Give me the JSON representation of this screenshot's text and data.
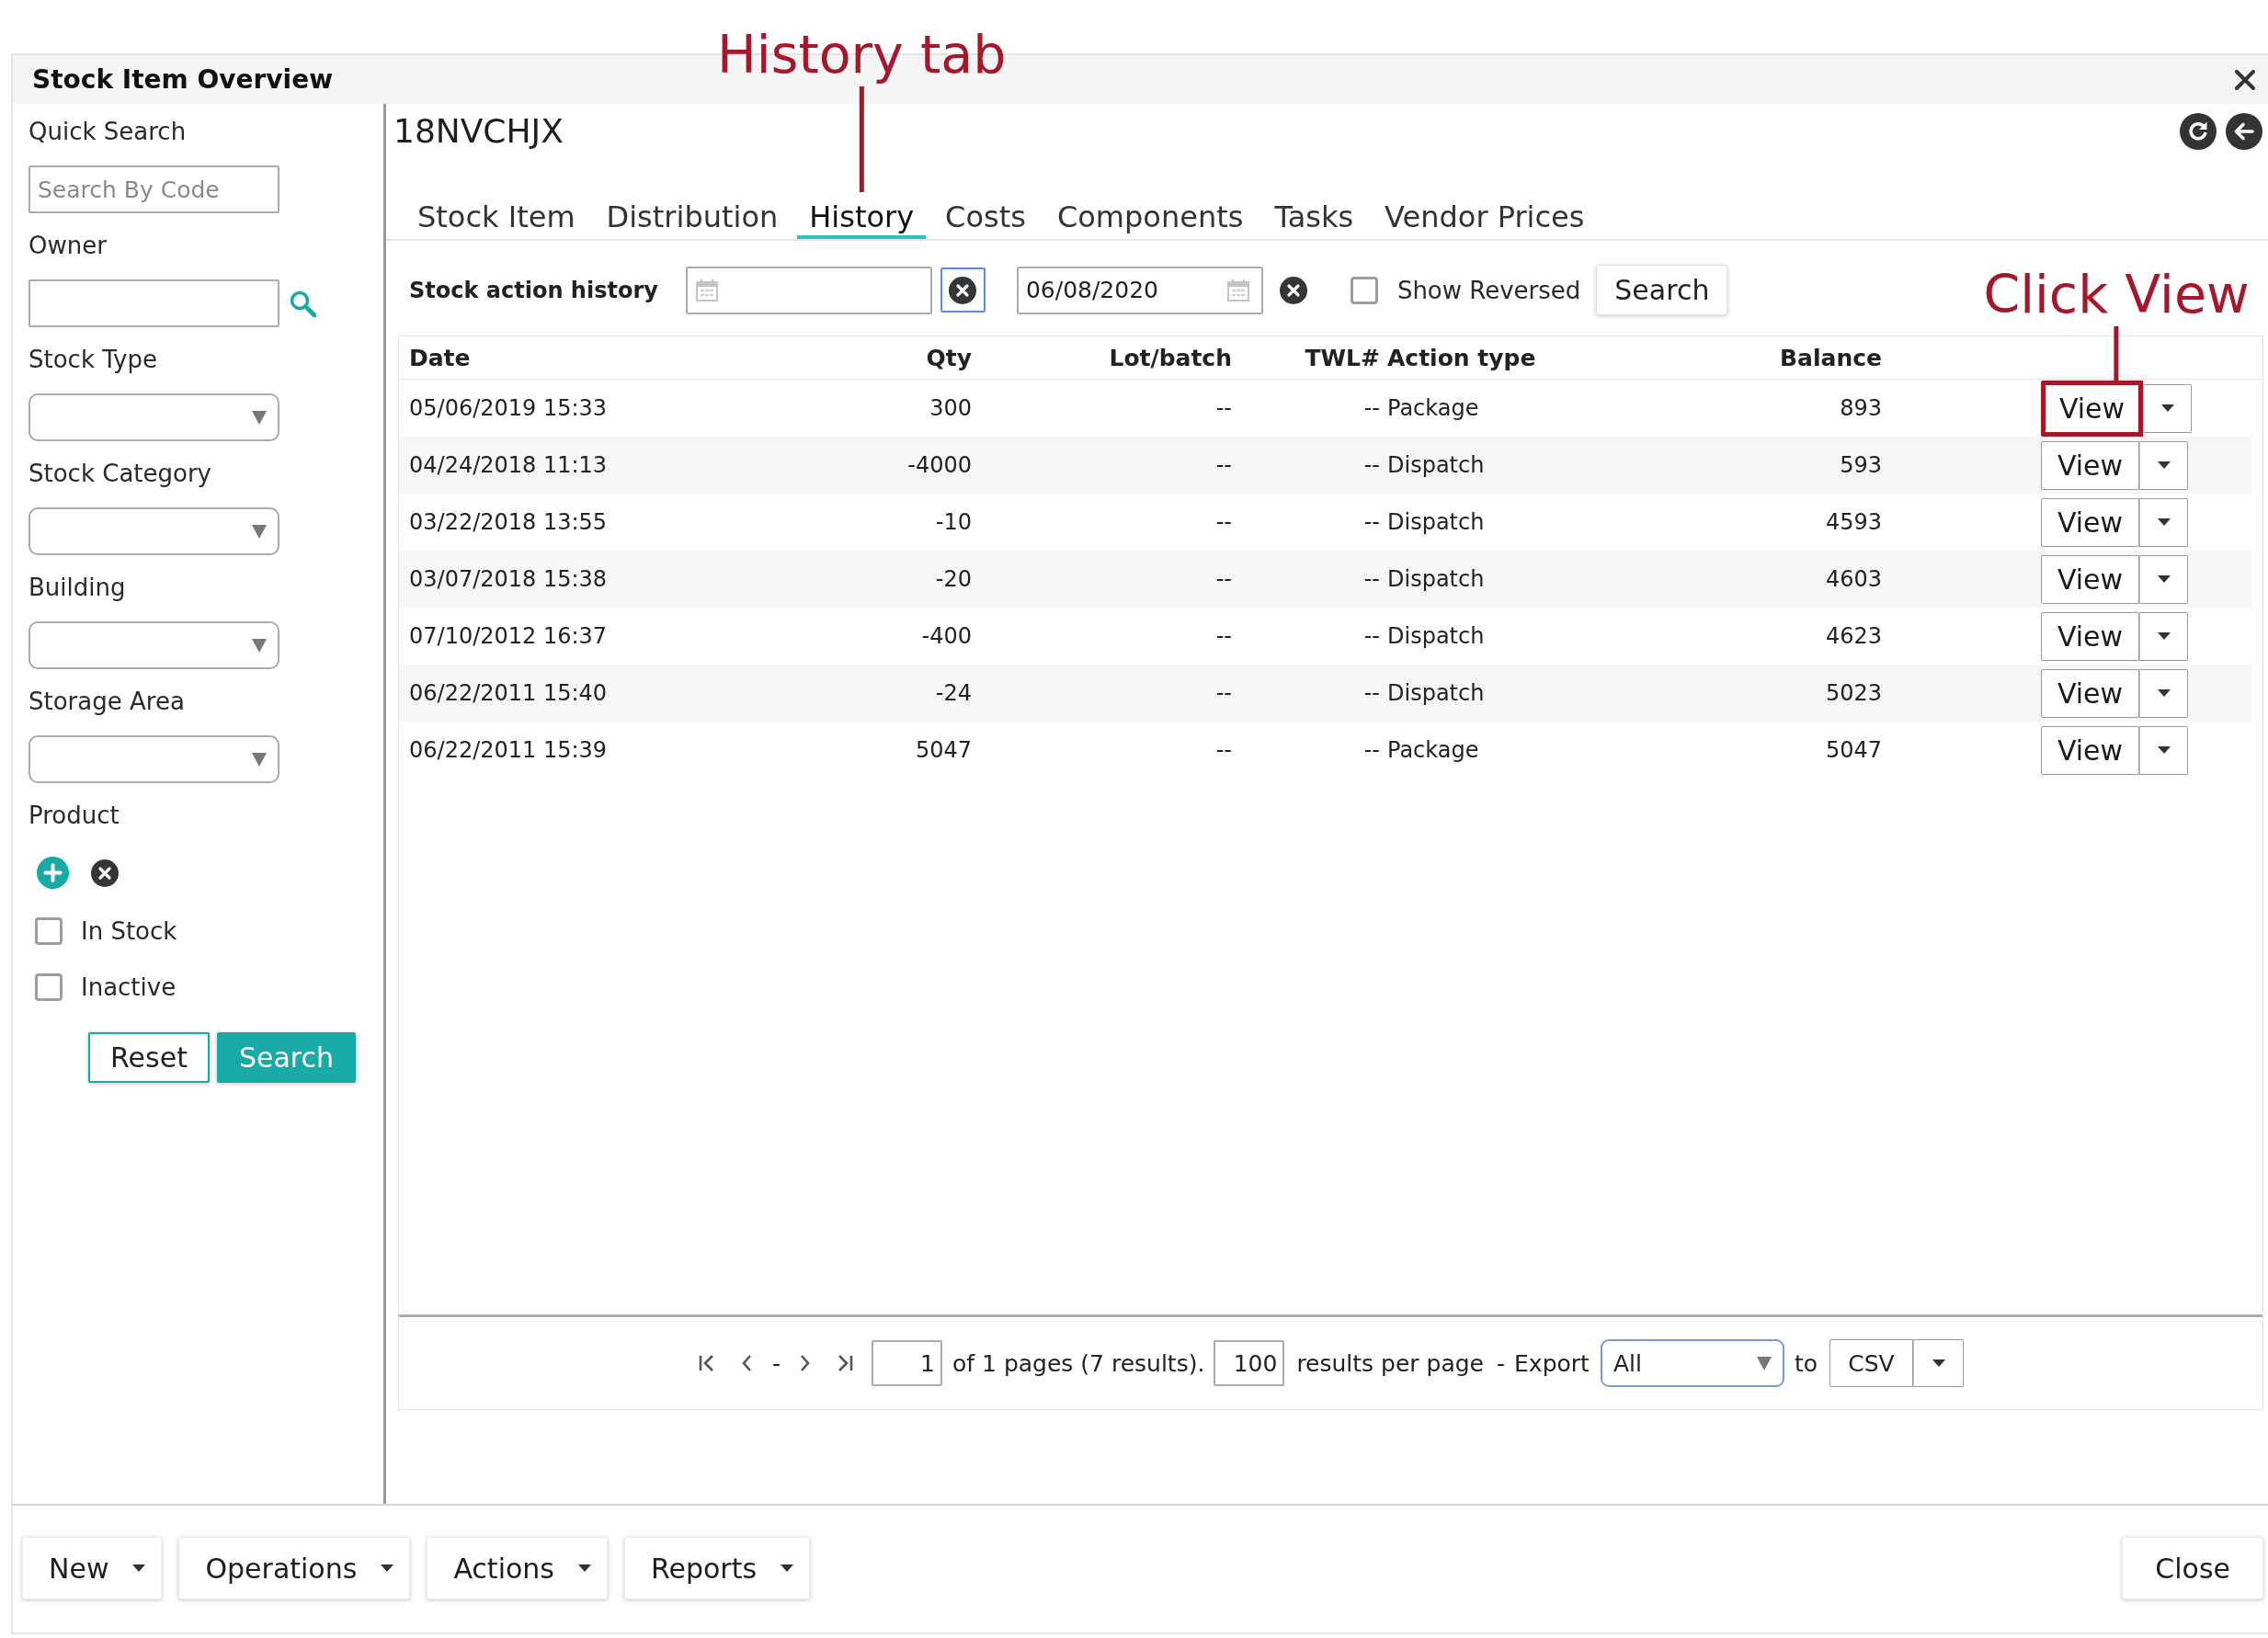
{
  "window": {
    "title": "Stock Item Overview"
  },
  "sidebar": {
    "fields": [
      {
        "kind": "text",
        "label": "Quick Search",
        "placeholder": "Search By Code"
      },
      {
        "kind": "lookup",
        "label": "Owner"
      },
      {
        "kind": "select",
        "label": "Stock Type"
      },
      {
        "kind": "select",
        "label": "Stock Category"
      },
      {
        "kind": "select",
        "label": "Building"
      },
      {
        "kind": "select",
        "label": "Storage Area"
      },
      {
        "kind": "product",
        "label": "Product"
      }
    ],
    "checkboxes": [
      {
        "label": "In Stock",
        "checked": false
      },
      {
        "label": "Inactive",
        "checked": false
      }
    ],
    "buttons": [
      {
        "kind": "secondary",
        "label": "Reset"
      },
      {
        "kind": "primary",
        "label": "Search"
      }
    ]
  },
  "item_code": "18NVCHJX",
  "tabs": [
    {
      "label": "Stock Item",
      "selected": false
    },
    {
      "label": "Distribution",
      "selected": false
    },
    {
      "label": "History",
      "selected": true,
      "callout": "History tab"
    },
    {
      "label": "Costs",
      "selected": false
    },
    {
      "label": "Components",
      "selected": false
    },
    {
      "label": "Tasks",
      "selected": false
    },
    {
      "label": "Vendor Prices",
      "selected": false
    }
  ],
  "history_filter": {
    "label": "Stock action history",
    "date_from": {
      "clear_focused": true
    },
    "date_to": {
      "value": "06/08/2020",
      "clear_focused": false
    },
    "show_reversed": {
      "label": "Show Reversed",
      "checked": false
    },
    "search_button": "Search"
  },
  "table": {
    "columns": [
      "Date",
      "Qty",
      "Lot/batch",
      "TWL#",
      "Action type",
      "Balance"
    ],
    "rows": [
      {
        "date": "05/06/2019 15:33",
        "qty": "300",
        "lot_batch": "--",
        "twl": "--",
        "action_type": "Package",
        "balance": "893",
        "button": "View",
        "highlighted": true,
        "callout": "Click View"
      },
      {
        "date": "04/24/2018 11:13",
        "qty": "-4000",
        "lot_batch": "--",
        "twl": "--",
        "action_type": "Dispatch",
        "balance": "593",
        "button": "View",
        "highlighted": false
      },
      {
        "date": "03/22/2018 13:55",
        "qty": "-10",
        "lot_batch": "--",
        "twl": "--",
        "action_type": "Dispatch",
        "balance": "4593",
        "button": "View",
        "highlighted": false
      },
      {
        "date": "03/07/2018 15:38",
        "qty": "-20",
        "lot_batch": "--",
        "twl": "--",
        "action_type": "Dispatch",
        "balance": "4603",
        "button": "View",
        "highlighted": false
      },
      {
        "date": "07/10/2012 16:37",
        "qty": "-400",
        "lot_batch": "--",
        "twl": "--",
        "action_type": "Dispatch",
        "balance": "4623",
        "button": "View",
        "highlighted": false
      },
      {
        "date": "06/22/2011 15:40",
        "qty": "-24",
        "lot_batch": "--",
        "twl": "--",
        "action_type": "Dispatch",
        "balance": "5023",
        "button": "View",
        "highlighted": false
      },
      {
        "date": "06/22/2011 15:39",
        "qty": "5047",
        "lot_batch": "--",
        "twl": "--",
        "action_type": "Package",
        "balance": "5047",
        "button": "View",
        "highlighted": false
      }
    ]
  },
  "pagination": {
    "nav_separator": "-",
    "page": "1",
    "page_summary": "of 1 pages (7 results).",
    "page_size": "100",
    "page_size_label": "results per page",
    "export_separator": "-",
    "export_label": "Export",
    "export_scope": "All",
    "to_label": "to",
    "export_format": "CSV"
  },
  "footer": {
    "menus": [
      {
        "label": "New"
      },
      {
        "label": "Operations"
      },
      {
        "label": "Actions"
      },
      {
        "label": "Reports"
      }
    ],
    "close_button": "Close"
  }
}
